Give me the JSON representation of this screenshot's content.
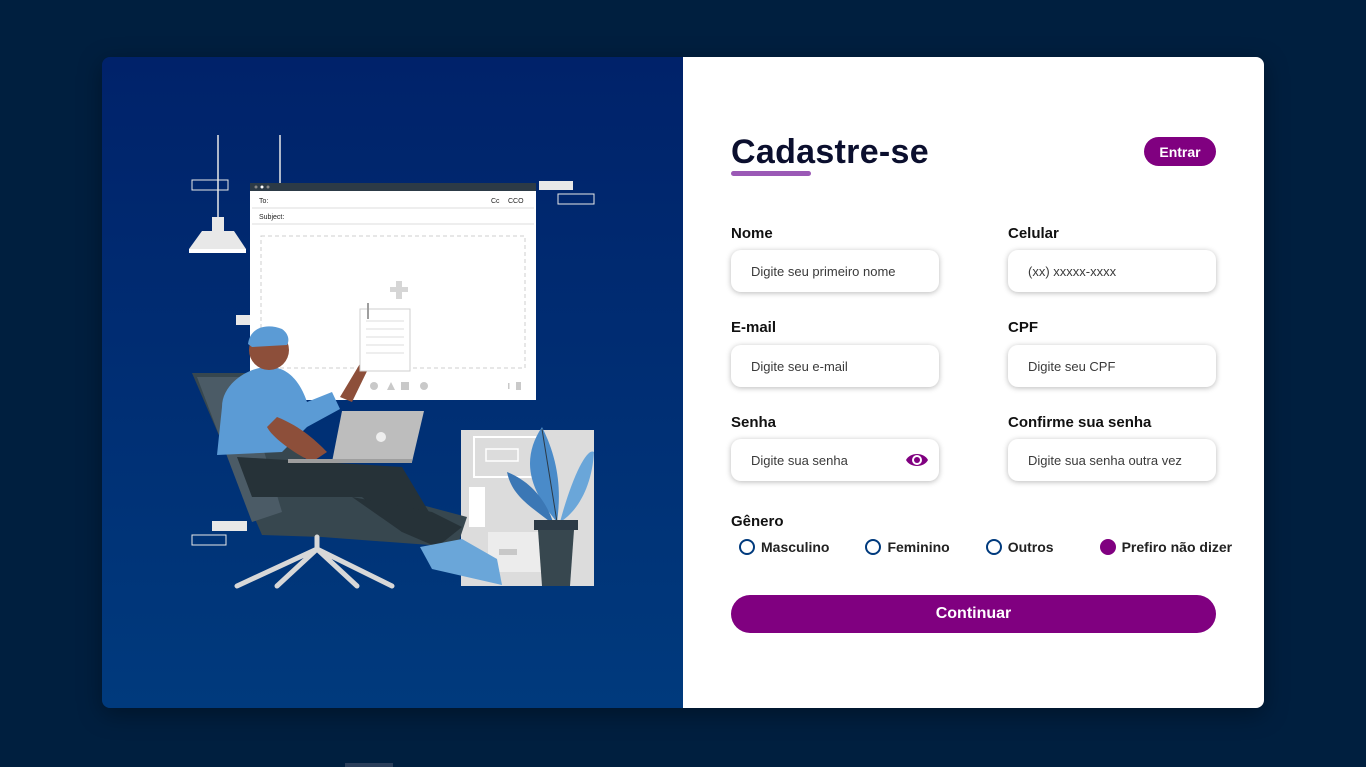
{
  "form": {
    "title": "Cadastre-se",
    "login_label": "Entrar",
    "fields": {
      "nome": {
        "label": "Nome",
        "placeholder": "Digite seu primeiro nome"
      },
      "celular": {
        "label": "Celular",
        "placeholder": "(xx) xxxxx-xxxx"
      },
      "email": {
        "label": "E-mail",
        "placeholder": "Digite seu e-mail"
      },
      "cpf": {
        "label": "CPF",
        "placeholder": "Digite seu CPF"
      },
      "senha": {
        "label": "Senha",
        "placeholder": "Digite sua senha"
      },
      "confirma": {
        "label": "Confirme sua senha",
        "placeholder": "Digite sua senha outra vez"
      }
    },
    "gender": {
      "label": "Gênero",
      "options": [
        {
          "label": "Masculino",
          "checked": false
        },
        {
          "label": "Feminino",
          "checked": false
        },
        {
          "label": "Outros",
          "checked": false
        },
        {
          "label": "Prefiro não dizer",
          "checked": true
        }
      ]
    },
    "continue_label": "Continuar"
  },
  "illustration": {
    "email_to": "To:",
    "email_subject": "Subject:",
    "email_cc": "Cc",
    "email_cco": "CCO"
  },
  "colors": {
    "accent": "#800080",
    "underline": "#9b59b6",
    "page_bg": "#001f3f",
    "panel_top": "#00226a",
    "panel_bottom": "#003a7d",
    "radio_border": "#003a7d"
  },
  "icons": {
    "password_toggle": "eye-icon"
  }
}
